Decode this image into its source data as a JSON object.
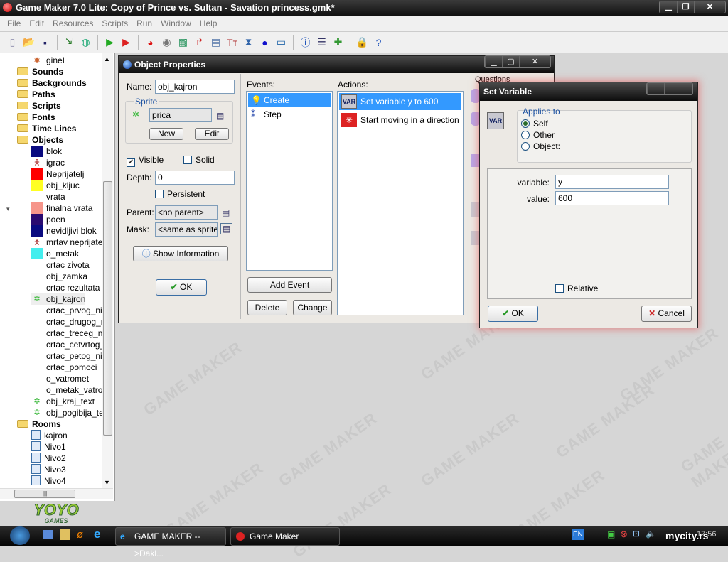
{
  "app": {
    "title": "Game Maker 7.0 Lite: Copy of Prince vs. Sultan - Savation princess.gmk*"
  },
  "menu": [
    "File",
    "Edit",
    "Resources",
    "Scripts",
    "Run",
    "Window",
    "Help"
  ],
  "toolbar": [
    "new-file-icon",
    "open-folder-icon",
    "save-icon",
    "export-executable-icon",
    "publish-icon",
    "run-icon",
    "debug-run-icon",
    "add-sprite-icon",
    "add-sound-icon",
    "add-background-icon",
    "add-path-icon",
    "add-script-icon",
    "add-font-icon",
    "add-timeline-icon",
    "add-object-icon",
    "add-room-icon",
    "game-information-icon",
    "global-settings-icon",
    "extension-packages-icon",
    "advanced-mode-icon",
    "help-icon"
  ],
  "tree": {
    "top_item": "gineL",
    "folders": [
      "Sounds",
      "Backgrounds",
      "Paths",
      "Scripts",
      "Fonts",
      "Time Lines",
      "Objects"
    ],
    "objects": [
      {
        "name": "blok",
        "color": "#0a0a80"
      },
      {
        "name": "igrac",
        "color": "figure"
      },
      {
        "name": "Neprijatelj",
        "color": "#ff0000"
      },
      {
        "name": "obj_kljuc",
        "color": "#ffff22"
      },
      {
        "name": "vrata",
        "color": "#ffffff"
      },
      {
        "name": "finalna vrata",
        "color": "#f6958a"
      },
      {
        "name": "poen",
        "color": "#2a0a70"
      },
      {
        "name": "nevidljivi blok",
        "color": "#0a0a80"
      },
      {
        "name": "mrtav neprijatelj",
        "color": "figure"
      },
      {
        "name": "o_metak",
        "color": "#44eeee"
      },
      {
        "name": "crtac zivota",
        "color": ""
      },
      {
        "name": "obj_zamka",
        "color": ""
      },
      {
        "name": "crtac rezultata",
        "color": ""
      },
      {
        "name": "obj_kajron",
        "color": "sprite"
      },
      {
        "name": "crtac_prvog_niv",
        "color": ""
      },
      {
        "name": "crtac_drugog_ni",
        "color": ""
      },
      {
        "name": "crtac_treceg_niv",
        "color": ""
      },
      {
        "name": "crtac_cetvrtog_r",
        "color": ""
      },
      {
        "name": "crtac_petog_niv",
        "color": ""
      },
      {
        "name": "crtac_pomoci",
        "color": ""
      },
      {
        "name": "o_vatromet",
        "color": ""
      },
      {
        "name": "o_metak_vatrom",
        "color": ""
      },
      {
        "name": "obj_kraj_text",
        "color": "sprite"
      },
      {
        "name": "obj_pogibija_text",
        "color": "sprite"
      }
    ],
    "rooms_folder": "Rooms",
    "rooms": [
      "kajron",
      "Nivo1",
      "Nivo2",
      "Nivo3",
      "Nivo4"
    ],
    "selected": "obj_kajron"
  },
  "logo": {
    "text": "YOYO",
    "sub": "GAMES"
  },
  "watermark": "GAME MAKER",
  "object_props": {
    "title": "Object Properties",
    "name_label": "Name:",
    "name_value": "obj_kajron",
    "sprite_group": "Sprite",
    "sprite_value": "prica",
    "new_btn": "New",
    "edit_btn": "Edit",
    "visible_label": "Visible",
    "visible": true,
    "solid_label": "Solid",
    "solid": false,
    "depth_label": "Depth:",
    "depth_value": "0",
    "persistent_label": "Persistent",
    "persistent": false,
    "parent_label": "Parent:",
    "parent_value": "<no parent>",
    "mask_label": "Mask:",
    "mask_value": "<same as sprite>",
    "show_info_btn": "Show Information",
    "ok_btn": "OK",
    "events_label": "Events:",
    "events": [
      "Create",
      "Step"
    ],
    "selected_event": "Create",
    "add_event_btn": "Add Event",
    "delete_btn": "Delete",
    "change_btn": "Change",
    "actions_label": "Actions:",
    "actions": [
      "Set variable y to 600",
      "Start moving in a direction"
    ],
    "questions_tab": "Questions"
  },
  "set_variable": {
    "title": "Set Variable",
    "applies_to": "Applies to",
    "options": [
      "Self",
      "Other",
      "Object:"
    ],
    "selected_option": "Self",
    "variable_label": "variable:",
    "variable_value": "y",
    "value_label": "value:",
    "value_value": "600",
    "relative_label": "Relative",
    "relative": false,
    "ok_btn": "OK",
    "cancel_btn": "Cancel"
  },
  "taskbar": {
    "tasks": [
      "GAME MAKER -->Dakl...",
      "Game Maker"
    ],
    "language": "EN",
    "clock": "17:56",
    "overlay": "mycity.rs"
  }
}
